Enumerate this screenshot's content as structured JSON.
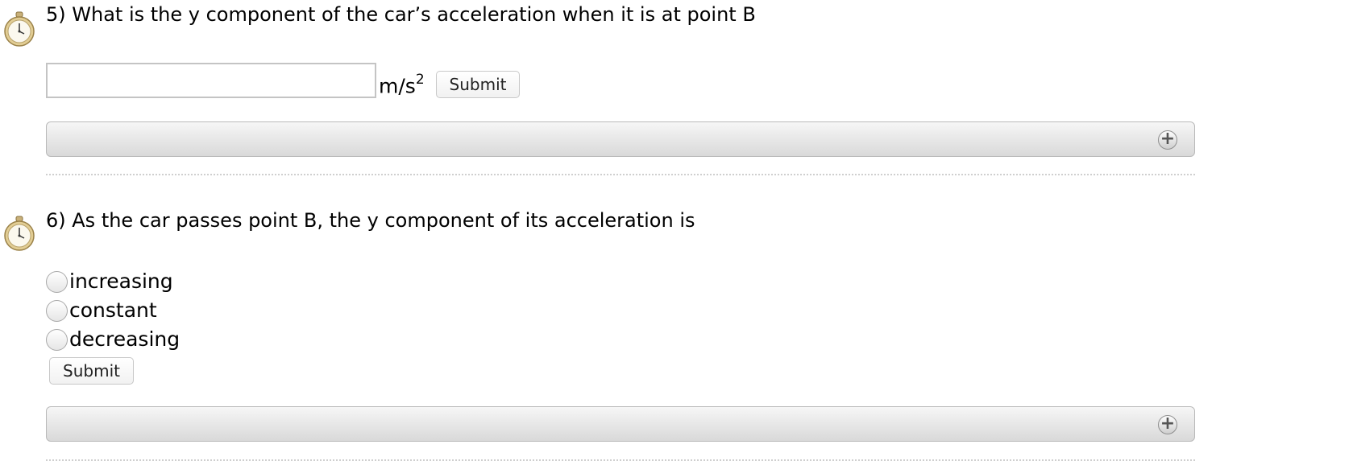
{
  "colors": {
    "text": "#000000",
    "hint_bar_top": "#f6f6f6",
    "hint_bar_bottom": "#d9d9d9",
    "divider": "#cfcfcf"
  },
  "questions": [
    {
      "text": "5) What is the y component of the car’s acceleration when it is at point B",
      "input_value": "",
      "unit_base": "m/s",
      "unit_exponent": "2",
      "submit_label": "Submit",
      "timer_icon": "stopwatch-icon",
      "hint_expand_icon": "plus-circle-icon"
    },
    {
      "text": "6) As the car passes point B, the y component of its acceleration is",
      "options": [
        "increasing",
        "constant",
        "decreasing"
      ],
      "submit_label": "Submit",
      "timer_icon": "stopwatch-icon",
      "hint_expand_icon": "plus-circle-icon"
    }
  ]
}
